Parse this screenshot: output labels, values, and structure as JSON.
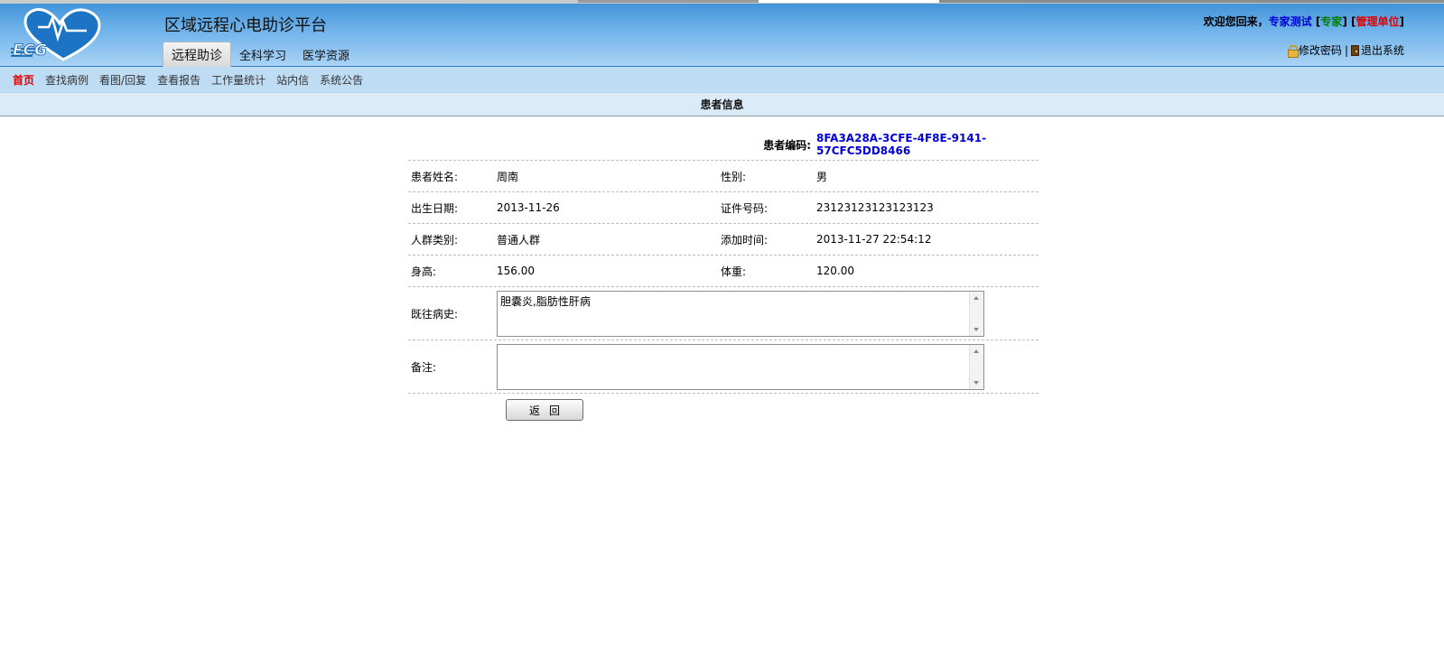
{
  "header": {
    "logo_text": "ECG",
    "app_title": "区域远程心电助诊平台",
    "main_tabs": [
      {
        "label": "远程助诊",
        "active": true
      },
      {
        "label": "全科学习",
        "active": false
      },
      {
        "label": "医学资源",
        "active": false
      }
    ],
    "welcome": {
      "prefix": "欢迎您回来，",
      "user": "专家测试",
      "role_open": " [",
      "role": "专家",
      "role_close": "]",
      "unit_open": " [",
      "unit": "管理单位",
      "unit_close": "]"
    },
    "links": {
      "change_password": "修改密码",
      "separator": "|",
      "logout": "退出系统"
    }
  },
  "subnav": {
    "items": [
      "首页",
      "查找病例",
      "看图/回复",
      "查看报告",
      "工作量统计",
      "站内信",
      "系统公告"
    ],
    "active_index": 0
  },
  "section": {
    "title": "患者信息"
  },
  "patient": {
    "code_label": "患者编码:",
    "code_value": "8FA3A28A-3CFE-4F8E-9141-57CFC5DD8466",
    "name_label": "患者姓名:",
    "name_value": "周南",
    "gender_label": "性别:",
    "gender_value": "男",
    "birth_label": "出生日期:",
    "birth_value": "2013-11-26",
    "id_label": "证件号码:",
    "id_value": "23123123123123123",
    "group_label": "人群类别:",
    "group_value": "普通人群",
    "added_label": "添加时间:",
    "added_value": "2013-11-27 22:54:12",
    "height_label": "身高:",
    "height_value": "156.00",
    "weight_label": "体重:",
    "weight_value": "120.00",
    "history_label": "既往病史:",
    "history_value": "胆囊炎,脂肪性肝病",
    "note_label": "备注:",
    "note_value": ""
  },
  "actions": {
    "back_label": "返回"
  },
  "colors": {
    "header_top": "#3b8fd6",
    "subnav_bg": "#bfdcf5",
    "section_bg": "#dcebf8",
    "link_blue": "#0000d8",
    "active_red": "#e00000",
    "role_green": "#008000"
  }
}
